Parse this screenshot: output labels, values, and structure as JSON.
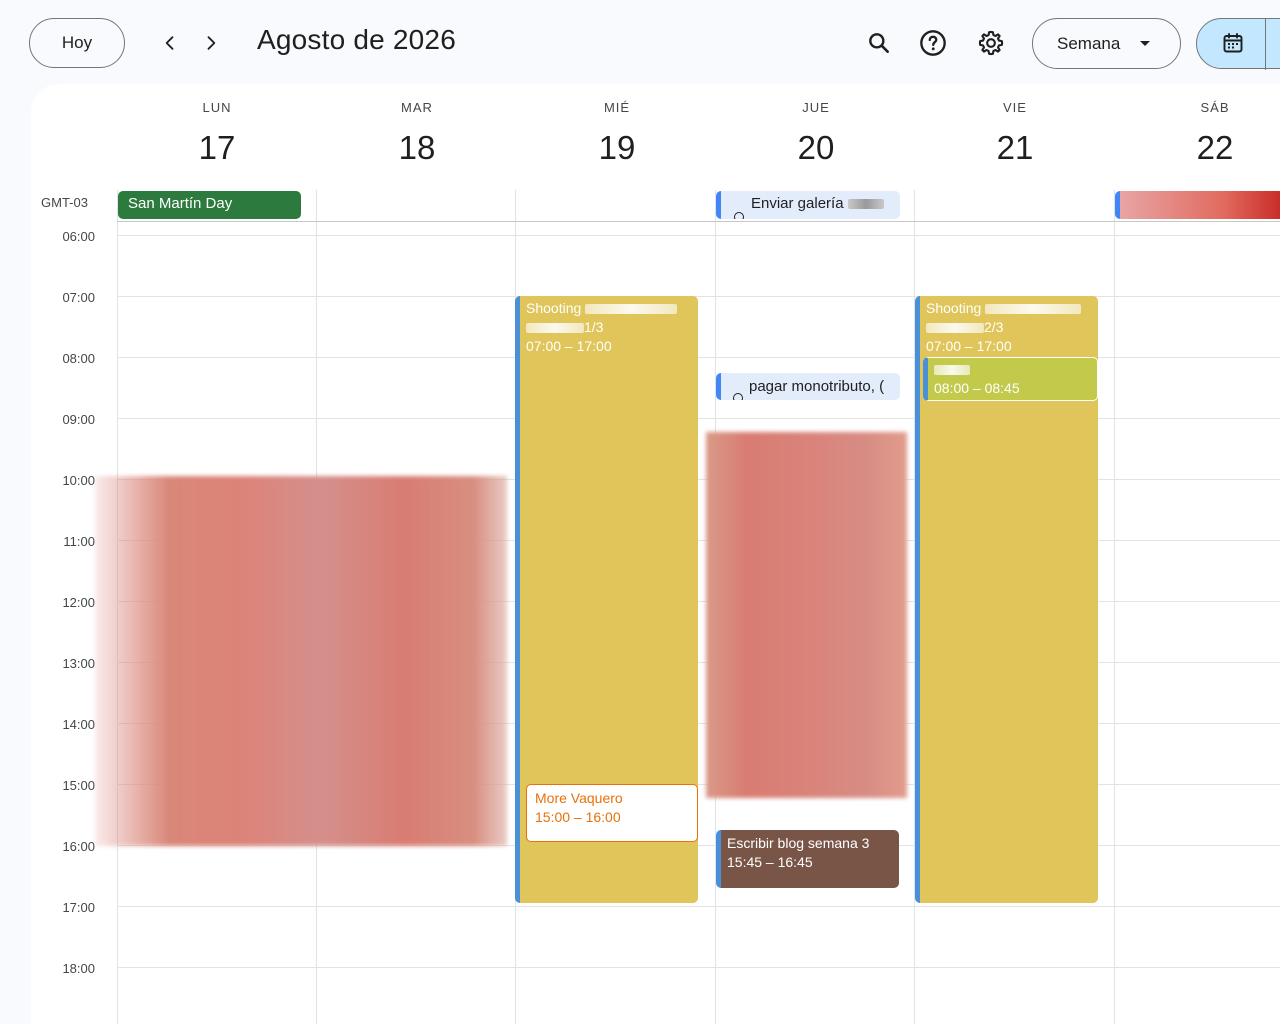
{
  "toolbar": {
    "today_label": "Hoy",
    "title": "Agosto de 2026",
    "view_label": "Semana"
  },
  "icons": {
    "prev": "chevron-left-icon",
    "next": "chevron-right-icon",
    "search": "search-icon",
    "help": "help-icon",
    "settings": "gear-icon",
    "calendar": "calendar-icon"
  },
  "timezone": "GMT-03",
  "days": [
    {
      "dow": "LUN",
      "num": "17"
    },
    {
      "dow": "MAR",
      "num": "18"
    },
    {
      "dow": "MIÉ",
      "num": "19"
    },
    {
      "dow": "JUE",
      "num": "20"
    },
    {
      "dow": "VIE",
      "num": "21"
    },
    {
      "dow": "SÁB",
      "num": "22"
    }
  ],
  "hours": [
    "06:00",
    "07:00",
    "08:00",
    "09:00",
    "10:00",
    "11:00",
    "12:00",
    "13:00",
    "14:00",
    "15:00",
    "16:00",
    "17:00",
    "18:00"
  ],
  "allday_events": {
    "mon": "San Martín Day",
    "thu": "Enviar galería"
  },
  "events": {
    "wed_shooting": {
      "title": "Shooting",
      "part": "1/3",
      "time": "07:00 – 17:00"
    },
    "wed_vaquero": {
      "title": "More Vaquero",
      "time": "15:00 – 16:00"
    },
    "thu_monotributo": {
      "title": "pagar monotributo, ("
    },
    "thu_blog": {
      "title": "Escribir blog semana 3",
      "time": "15:45 – 16:45"
    },
    "fri_shooting": {
      "title": "Shooting",
      "part": "2/3",
      "time": "07:00 – 17:00"
    },
    "fri_small": {
      "time": "08:00 – 08:45"
    }
  },
  "colors": {
    "accent_blue": "#4285f4",
    "yellow_event": "#e0c55b",
    "brown_event": "#795548",
    "orange_event": "#e8710a",
    "green_event": "#2d7a3e",
    "lime_event": "#c3c94b"
  }
}
